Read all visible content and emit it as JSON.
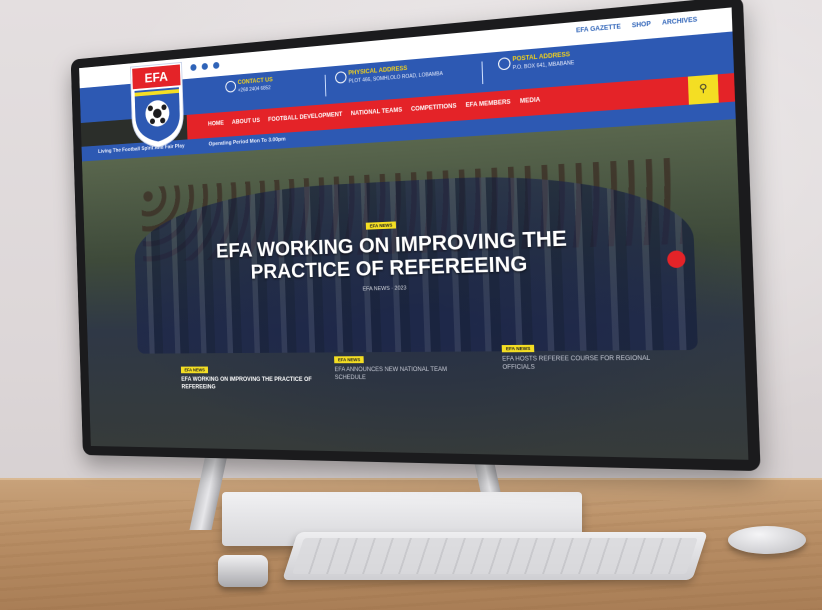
{
  "site": {
    "logo_text": "EFA",
    "top_links": [
      "EFA GAZETTE",
      "SHOP",
      "ARCHIVES"
    ],
    "info": [
      {
        "title": "CONTACT US",
        "detail": "+268 2404 6852"
      },
      {
        "title": "PHYSICAL ADDRESS",
        "detail": "PLOT 466, SOMHLOLO ROAD, LOBAMBA"
      },
      {
        "title": "POSTAL ADDRESS",
        "detail": "P.O. BOX 641, MBABANE"
      }
    ],
    "nav": [
      "HOME",
      "ABOUT US",
      "FOOTBALL DEVELOPMENT",
      "NATIONAL TEAMS",
      "COMPETITIONS",
      "EFA MEMBERS",
      "MEDIA"
    ],
    "search_icon": "search-icon",
    "tickers": [
      "Living The Football Spirit And Fair Play",
      "Operating Period Mon To 3.00pm"
    ],
    "accent_colors": {
      "blue": "#2d59b3",
      "red": "#e42328",
      "yellow": "#f4de23"
    }
  },
  "hero": {
    "badge": "EFA NEWS",
    "title_line1": "EFA WORKING ON IMPROVING THE",
    "title_line2": "PRACTICE OF REFEREEING",
    "meta": "EFA NEWS · 2023"
  },
  "cards": [
    {
      "badge": "EFA NEWS",
      "title": "EFA WORKING ON IMPROVING THE PRACTICE OF REFEREEING"
    },
    {
      "badge": "EFA NEWS",
      "title": "EFA ANNOUNCES NEW NATIONAL TEAM SCHEDULE"
    },
    {
      "badge": "EFA NEWS",
      "title": "EFA HOSTS REFEREE COURSE FOR REGIONAL OFFICIALS"
    }
  ]
}
